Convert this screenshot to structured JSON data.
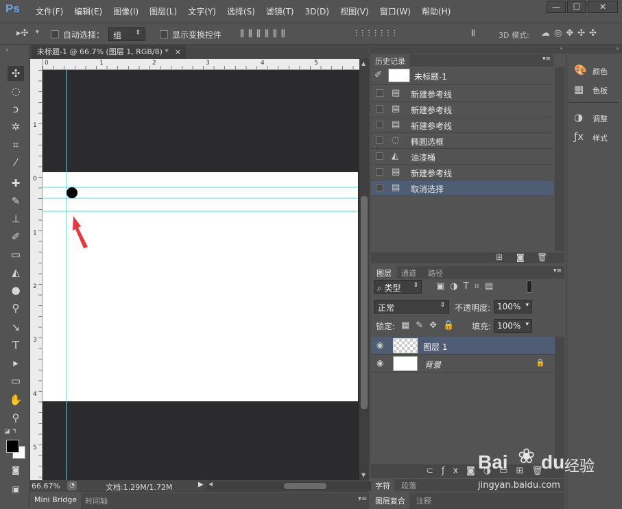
{
  "app": {
    "logo": "Ps",
    "menu": [
      "文件(F)",
      "编辑(E)",
      "图像(I)",
      "图层(L)",
      "文字(Y)",
      "选择(S)",
      "滤镜(T)",
      "3D(D)",
      "视图(V)",
      "窗口(W)",
      "帮助(H)"
    ],
    "window_buttons": [
      "—",
      "☐",
      "✕"
    ]
  },
  "options": {
    "auto_select_label": "自动选择：",
    "auto_select_value": "组",
    "show_transform_label": "显示变换控件",
    "mode_label": "3D 模式:"
  },
  "document": {
    "tab_title": "未标题-1 @ 66.7% (图层 1, RGB/8) *",
    "close": "×",
    "ruler_top": [
      "0",
      "1",
      "2",
      "3",
      "4",
      "5"
    ],
    "ruler_left": [
      "1",
      "0",
      "1",
      "2",
      "3",
      "4",
      "5"
    ]
  },
  "status": {
    "zoom": "66.67%",
    "doc_info": "文档:1.29M/1.72M"
  },
  "bottom_tabs": {
    "tab1": "Mini Bridge",
    "tab2": "时间轴"
  },
  "history": {
    "title": "历史记录",
    "snapshot": "未标题-1",
    "items": [
      {
        "label": "新建参考线",
        "icon": "▤"
      },
      {
        "label": "新建参考线",
        "icon": "▤"
      },
      {
        "label": "新建参考线",
        "icon": "▤"
      },
      {
        "label": "椭圆选框",
        "icon": "◌"
      },
      {
        "label": "油漆桶",
        "icon": "◭"
      },
      {
        "label": "新建参考线",
        "icon": "▤"
      },
      {
        "label": "取消选择",
        "icon": "▤"
      }
    ]
  },
  "layers": {
    "tabs": [
      "图层",
      "通道",
      "路径"
    ],
    "filter": "类型",
    "blend": "正常",
    "opacity_label": "不透明度:",
    "opacity": "100%",
    "lock_label": "锁定:",
    "fill_label": "填充:",
    "fill": "100%",
    "items": [
      {
        "name": "图层 1"
      },
      {
        "name": "背景"
      }
    ]
  },
  "panel_bottom": {
    "tab1": "字符",
    "tab2": "段落",
    "tab3": "图层复合",
    "tab4": "注释"
  },
  "right_panel": {
    "color": "颜色",
    "swatches": "色板",
    "adjustments": "调整",
    "styles": "样式"
  },
  "watermark": {
    "brand": "Bai",
    "brand2": "du",
    "text": "经验",
    "url": "jingyan.baidu.com"
  },
  "colors": {
    "guide": "#40e0e0",
    "arrow": "#e8383d",
    "selection": "#4f5d74"
  }
}
